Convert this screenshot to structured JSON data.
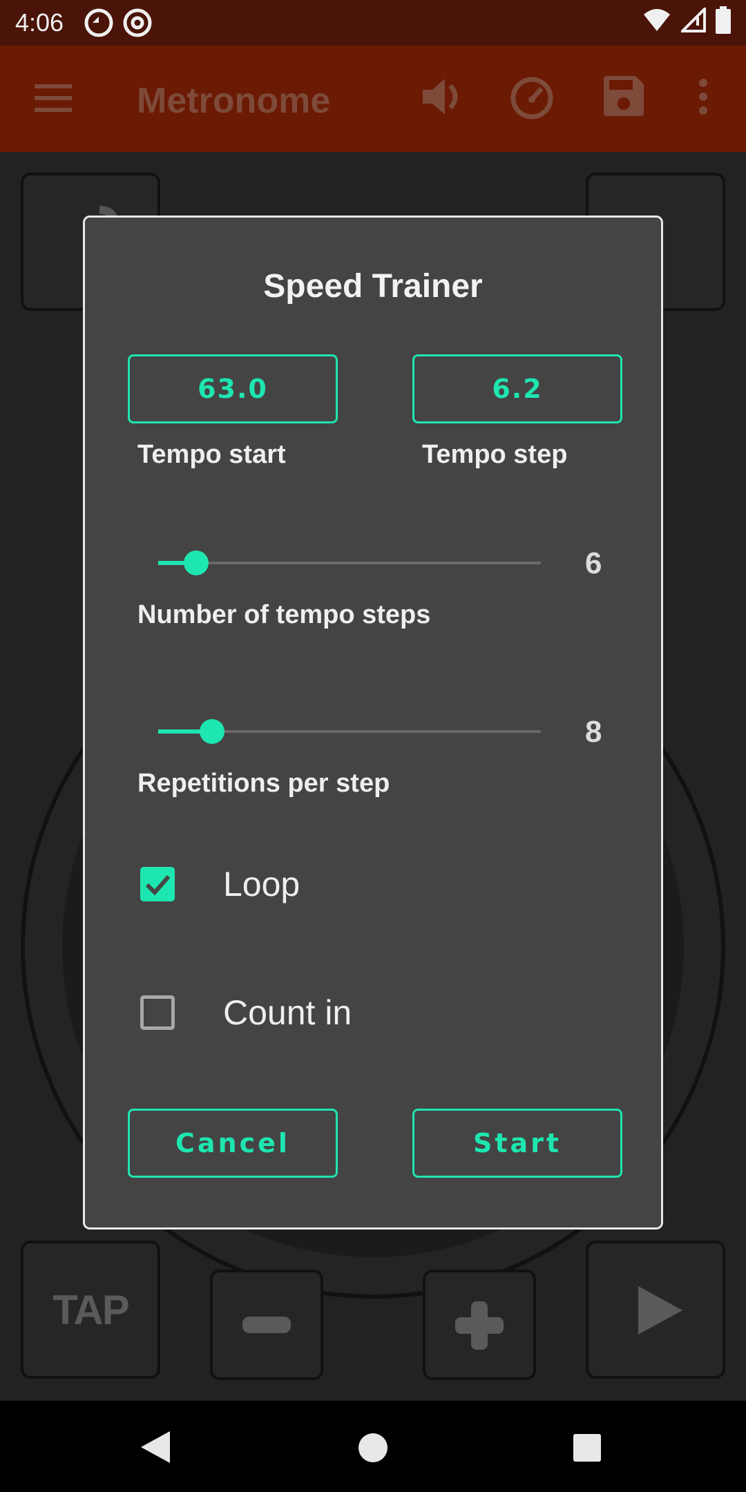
{
  "status_bar": {
    "time": "4:06"
  },
  "app_bar": {
    "title": "Metronome"
  },
  "background": {
    "tap_label": "TAP"
  },
  "dialog": {
    "title": "Speed Trainer",
    "tempo_start": {
      "value": "63.0",
      "label": "Tempo start"
    },
    "tempo_step": {
      "value": "6.2",
      "label": "Tempo step"
    },
    "tempo_steps": {
      "label": "Number of tempo steps",
      "value": "6",
      "fraction": 0.1
    },
    "repetitions": {
      "label": "Repetitions per step",
      "value": "8",
      "fraction": 0.14
    },
    "loop": {
      "label": "Loop",
      "checked": true
    },
    "count_in": {
      "label": "Count in",
      "checked": false
    },
    "cancel_label": "Cancel",
    "start_label": "Start"
  },
  "colors": {
    "accent": "#1ee6b0",
    "app_bar": "#6b1a04",
    "status_bar": "#4a1408",
    "dialog_bg": "#444444"
  }
}
